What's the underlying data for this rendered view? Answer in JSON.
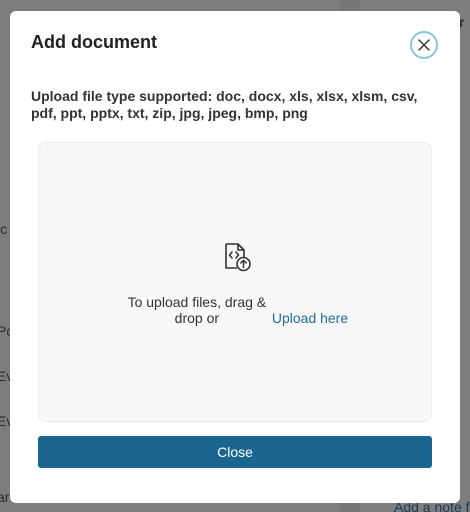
{
  "background": {
    "left_fragments": [
      "ic",
      "Po",
      "Ev",
      "Ev",
      "ar"
    ],
    "right_fragments": [
      "er"
    ],
    "right_link": "Add a note f"
  },
  "modal": {
    "title": "Add document",
    "close_icon": "close-icon",
    "supported_types": "Upload file type supported: doc, docx, xls, xlsx, xlsm, csv, pdf, ppt, pptx, txt, zip, jpg, jpeg, bmp, png",
    "dropzone": {
      "icon": "file-code-upload-icon",
      "text_prefix": "To upload files, drag & drop or",
      "link_label": "Upload here"
    },
    "close_button_label": "Close"
  },
  "colors": {
    "primary": "#1b6690",
    "link": "#1f6c9a",
    "close_ring": "#8fc3df"
  }
}
